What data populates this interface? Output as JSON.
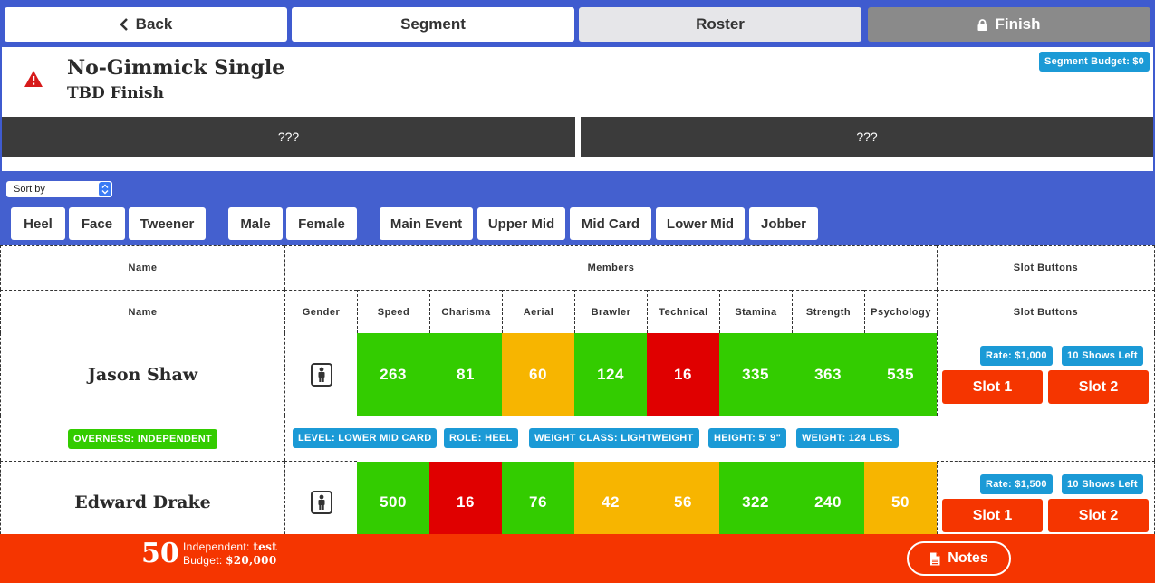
{
  "nav": {
    "back": "Back",
    "segment": "Segment",
    "roster": "Roster",
    "finish": "Finish"
  },
  "segment": {
    "title": "No-Gimmick Single",
    "subtitle": "TBD Finish",
    "budget": "Segment Budget: $0",
    "slots": [
      "???",
      "???"
    ]
  },
  "filters": {
    "sort_label": "Sort by",
    "alignment": [
      "Heel",
      "Face",
      "Tweener"
    ],
    "gender": [
      "Male",
      "Female"
    ],
    "tier": [
      "Main Event",
      "Upper Mid",
      "Mid Card",
      "Lower Mid",
      "Jobber"
    ]
  },
  "table": {
    "groups": {
      "name": "Name",
      "members": "Members",
      "slots": "Slot Buttons"
    },
    "columns": {
      "name": "Name",
      "gender": "Gender",
      "stats": [
        "Speed",
        "Charisma",
        "Aerial",
        "Brawler",
        "Technical",
        "Stamina",
        "Strength",
        "Psychology"
      ],
      "slots": "Slot Buttons"
    },
    "rows": [
      {
        "name": "Jason Shaw",
        "stats": [
          "263",
          "81",
          "60",
          "124",
          "16",
          "335",
          "363",
          "535"
        ],
        "colors": [
          "green",
          "green",
          "yellow",
          "green",
          "red",
          "green",
          "green",
          "green"
        ],
        "rate": "Rate: $1,000",
        "shows": "10 Shows Left",
        "slot1": "Slot 1",
        "slot2": "Slot 2",
        "overness": "OVERNESS: INDEPENDENT",
        "details": [
          "LEVEL: LOWER MID CARD",
          "ROLE: HEEL",
          "WEIGHT CLASS: LIGHTWEIGHT",
          "HEIGHT: 5' 9\"",
          "WEIGHT: 124 LBS."
        ]
      },
      {
        "name": "Edward Drake",
        "stats": [
          "500",
          "16",
          "76",
          "42",
          "56",
          "322",
          "240",
          "50"
        ],
        "colors": [
          "green",
          "red",
          "green",
          "yellow",
          "yellow",
          "green",
          "green",
          "yellow"
        ],
        "rate": "Rate: $1,500",
        "shows": "10 Shows Left",
        "slot1": "Slot 1",
        "slot2": "Slot 2"
      }
    ]
  },
  "footer": {
    "count": "50",
    "promotion_label": "Independent:",
    "promotion_value": "test",
    "budget_label": "Budget:",
    "budget_value": "$20,000",
    "notes": "Notes"
  },
  "icons": {
    "back": "chevron-left-icon",
    "finish": "lock-icon",
    "warning": "warning-triangle-icon",
    "gender": "male-person-icon",
    "notes": "document-icon",
    "sort": "select-arrows-icon"
  },
  "colors": {
    "nav_blue": "#3f5bcf",
    "stat_green": "#33cc00",
    "stat_red": "#e00000",
    "stat_yellow": "#f7b500",
    "badge_blue": "#1b9ad6",
    "action_red": "#f53500"
  }
}
